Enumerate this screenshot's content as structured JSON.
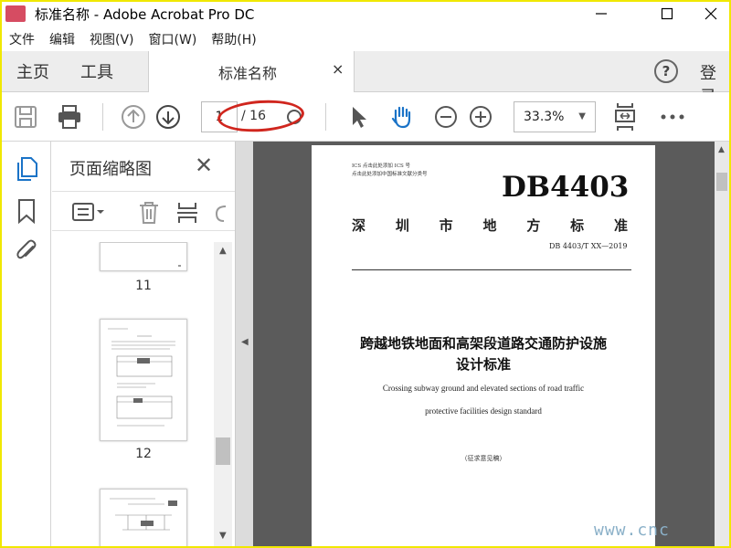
{
  "window": {
    "title": "标准名称 - Adobe Acrobat Pro DC",
    "minimize_icon": "minimize-icon",
    "maximize_icon": "maximize-icon",
    "close_icon": "close-icon"
  },
  "menu": {
    "items": [
      "文件",
      "编辑",
      "视图(V)",
      "窗口(W)",
      "帮助(H)"
    ]
  },
  "tabs": {
    "home": "主页",
    "tools": "工具",
    "document": "标准名称",
    "close_glyph": "×",
    "help_glyph": "?",
    "login": "登录"
  },
  "toolbar": {
    "current_page": "1",
    "total_pages": "/ 16",
    "zoom": "33.3%",
    "zoom_caret": "▼"
  },
  "thumbnails": {
    "title": "页面缩略图",
    "pages": [
      {
        "number": "11"
      },
      {
        "number": "12"
      }
    ]
  },
  "document": {
    "header_line1": "ICS 点击此处添加 ICS 号",
    "header_line2": "点击此处添加中国标准文献分类号",
    "code": "DB4403",
    "region": [
      "深",
      "圳",
      "市",
      "地",
      "方",
      "标",
      "准"
    ],
    "std_number": "DB 4403/T XX—2019",
    "title_cn_line1": "跨越地铁地面和高架段道路交通防护设施",
    "title_cn_line2": "设计标准",
    "title_en_line1": "Crossing subway ground and elevated sections of road traffic",
    "title_en_line2": "protective facilities design standard",
    "draft_note": "（征求意见稿）"
  },
  "watermark": "www.cnc",
  "colors": {
    "frame": "#f0e800",
    "highlight_ellipse": "#d0261e",
    "viewer_bg": "#5b5b5b",
    "accent_blue": "#1a73c7"
  }
}
